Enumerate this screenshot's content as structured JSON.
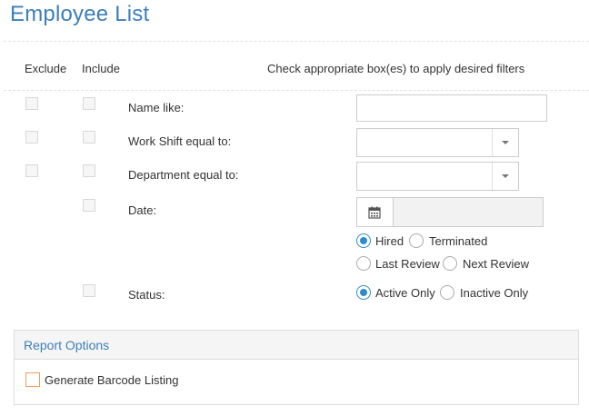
{
  "page": {
    "title": "Employee List"
  },
  "columns": {
    "exclude": "Exclude",
    "include": "Include",
    "instruction": "Check appropriate box(es) to apply desired filters"
  },
  "filters": {
    "name": {
      "label": "Name like:",
      "value": ""
    },
    "work_shift": {
      "label": "Work Shift equal to:",
      "selected": ""
    },
    "department": {
      "label": "Department equal to:",
      "selected": ""
    },
    "date": {
      "label": "Date:",
      "value": "",
      "options": [
        "Hired",
        "Terminated",
        "Last Review",
        "Next Review"
      ],
      "selected": "Hired"
    },
    "status": {
      "label": "Status:",
      "options": [
        "Active Only",
        "Inactive Only"
      ],
      "selected": "Active Only"
    }
  },
  "report_options": {
    "title": "Report Options",
    "barcode_label": "Generate Barcode Listing",
    "barcode_checked": false
  },
  "colors": {
    "accent": "#3d7fb8",
    "radio": "#2f8ccc",
    "checkbox_orange": "#e8a060"
  }
}
